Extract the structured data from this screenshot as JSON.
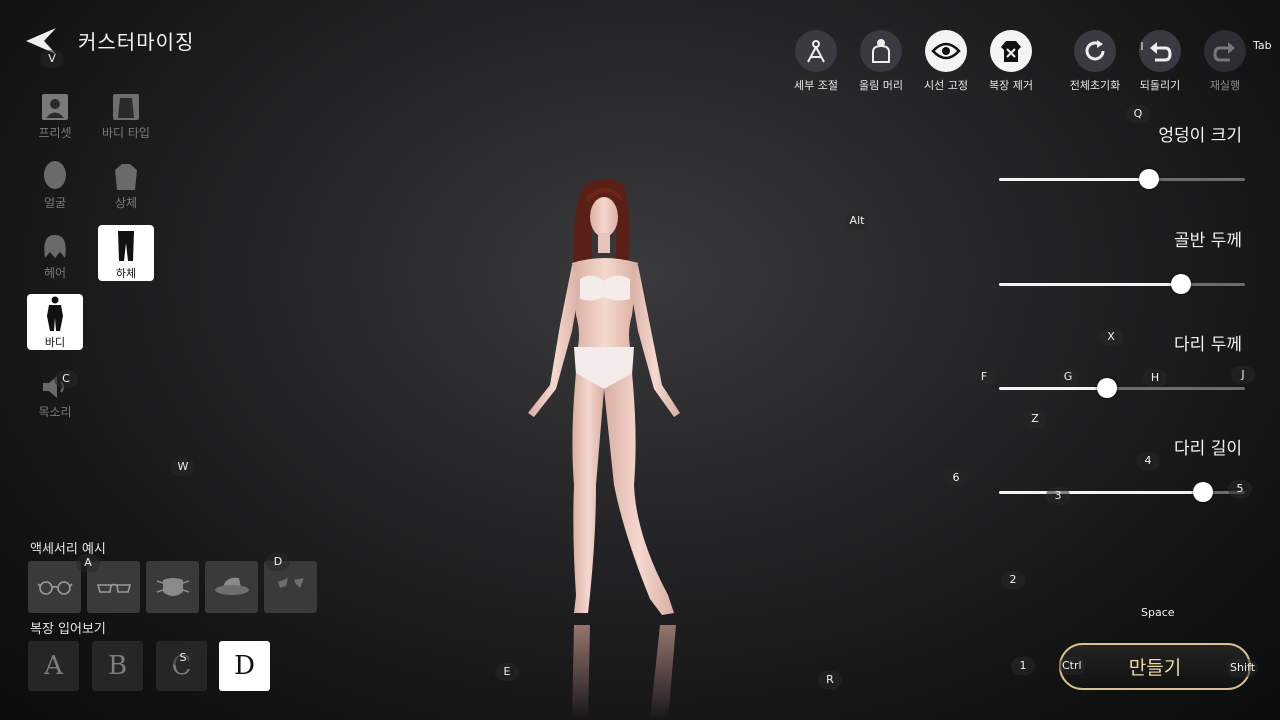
{
  "header": {
    "title": "커스터마이징"
  },
  "categories": [
    {
      "key": "preset",
      "label": "프리셋",
      "icon": "portrait-icon",
      "active": false
    },
    {
      "key": "body-type",
      "label": "바디 타입",
      "icon": "torso-icon",
      "active": false
    },
    {
      "key": "face",
      "label": "얼굴",
      "icon": "face-icon",
      "active": false
    },
    {
      "key": "upper",
      "label": "상체",
      "icon": "upper-body-icon",
      "active": false
    },
    {
      "key": "hair",
      "label": "헤어",
      "icon": "hair-icon",
      "active": false
    },
    {
      "key": "lower",
      "label": "하체",
      "icon": "legs-icon",
      "active": true
    },
    {
      "key": "body",
      "label": "바디",
      "icon": "body-icon",
      "active": true
    },
    {
      "key": "voice",
      "label": "목소리",
      "icon": "speaker-icon",
      "active": false
    }
  ],
  "toolbar": [
    {
      "key": "detail",
      "label": "세부 조절",
      "icon": "compass-icon"
    },
    {
      "key": "updo",
      "label": "올림 머리",
      "icon": "updo-hair-icon"
    },
    {
      "key": "gaze",
      "label": "시선 고정",
      "icon": "eye-icon"
    },
    {
      "key": "remove-outfit",
      "label": "복장 제거",
      "icon": "remove-outfit-icon"
    },
    {
      "key": "reset",
      "label": "전체초기화",
      "icon": "reset-icon"
    },
    {
      "key": "undo",
      "label": "되돌리기",
      "icon": "undo-icon"
    },
    {
      "key": "redo",
      "label": "재실행",
      "icon": "redo-icon"
    }
  ],
  "sliders": [
    {
      "label": "엉덩이 크기",
      "value": 0.61
    },
    {
      "label": "골반 두께",
      "value": 0.74
    },
    {
      "label": "다리 두께",
      "value": 0.44
    },
    {
      "label": "다리 길이",
      "value": 0.83
    }
  ],
  "accessories": {
    "title": "액세서리 예시",
    "items": [
      "round-glasses-icon",
      "glasses-icon",
      "mask-icon",
      "hat-icon",
      "hair-clip-icon"
    ]
  },
  "outfit_preview": {
    "title": "복장 입어보기",
    "options": [
      "A",
      "B",
      "C",
      "D"
    ],
    "selected": "D"
  },
  "create_button": {
    "label": "만들기"
  },
  "key_hints": {
    "back": "V",
    "tab": "Tab",
    "reset": "I",
    "q": "Q",
    "alt": "Alt",
    "x": "X",
    "f": "F",
    "g": "G",
    "h": "H",
    "j": "J",
    "z": "Z",
    "k4": "4",
    "k6": "6",
    "k3": "3",
    "k5": "5",
    "k2": "2",
    "space": "Space",
    "k1": "1",
    "ctrl": "Ctrl",
    "shift": "Shift",
    "voice": "C",
    "w": "W",
    "acc": "A",
    "d": "D",
    "s": "S",
    "e": "E",
    "r": "R"
  },
  "colors": {
    "accent_gold": "#d7c08a",
    "button_text": "#f0d9a1"
  }
}
